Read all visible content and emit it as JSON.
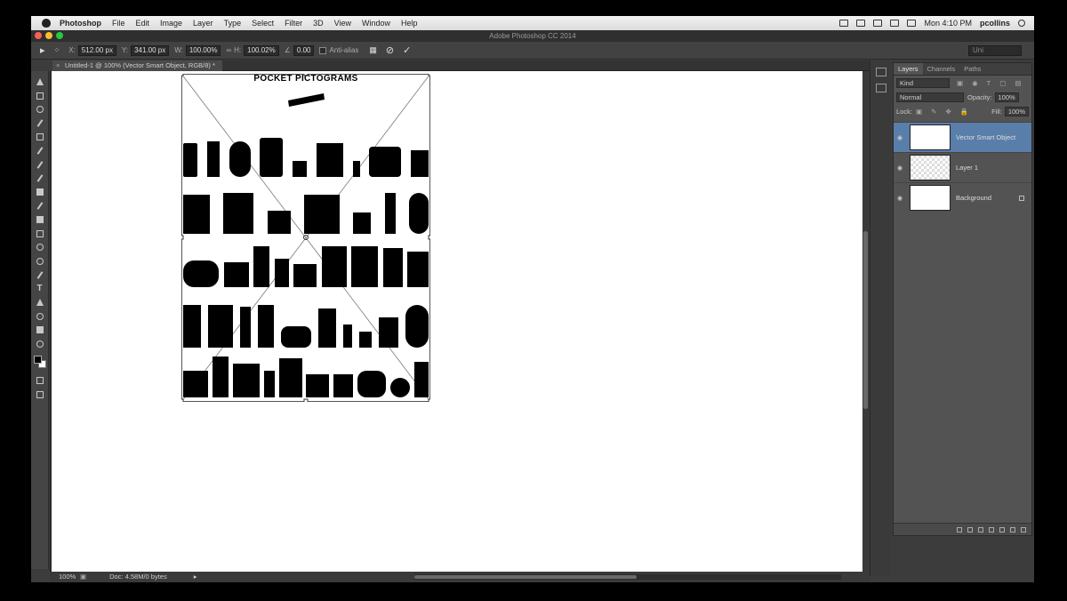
{
  "menubar": {
    "app_name": "Photoshop",
    "items": [
      "File",
      "Edit",
      "Image",
      "Layer",
      "Type",
      "Select",
      "Filter",
      "3D",
      "View",
      "Window",
      "Help"
    ],
    "clock": "Mon 4:10 PM",
    "user": "pcollins"
  },
  "window": {
    "title": "Adobe Photoshop CC 2014",
    "traffic_colors": [
      "#fc5f57",
      "#fdbc2e",
      "#28c840"
    ]
  },
  "options": {
    "x_label": "X:",
    "x_value": "512.00 px",
    "y_label": "Y:",
    "y_value": "341.00 px",
    "w_label": "W:",
    "w_value": "100.00%",
    "h_label": "H:",
    "h_value": "100.02%",
    "angle_value": "0.00",
    "antialias_label": "Anti-alias",
    "uni_label": "Uni"
  },
  "document": {
    "tab_title": "Untitled-1 @ 100% (Vector Smart Object, RGB/8) *",
    "artwork_title": "POCKET PICTOGRAMS"
  },
  "tools": [
    "move-icon",
    "marquee-icon",
    "lasso-icon",
    "quick-select-icon",
    "crop-icon",
    "eyedropper-icon",
    "healing-icon",
    "brush-icon",
    "stamp-icon",
    "history-brush-icon",
    "eraser-icon",
    "gradient-icon",
    "blur-icon",
    "dodge-icon",
    "pen-icon",
    "type-icon",
    "path-select-icon",
    "shape-icon",
    "hand-icon",
    "zoom-icon"
  ],
  "layers_panel": {
    "tabs": [
      "Layers",
      "Channels",
      "Paths"
    ],
    "kind_label": "Kind",
    "blend_mode": "Normal",
    "opacity_label": "Opacity:",
    "opacity_value": "100%",
    "lock_label": "Lock:",
    "fill_label": "Fill:",
    "fill_value": "100%",
    "layers": [
      {
        "name": "Vector Smart Object"
      },
      {
        "name": "Layer 1"
      },
      {
        "name": "Background"
      }
    ]
  },
  "status": {
    "zoom": "100%",
    "doc": "Doc: 4.58M/0 bytes"
  }
}
